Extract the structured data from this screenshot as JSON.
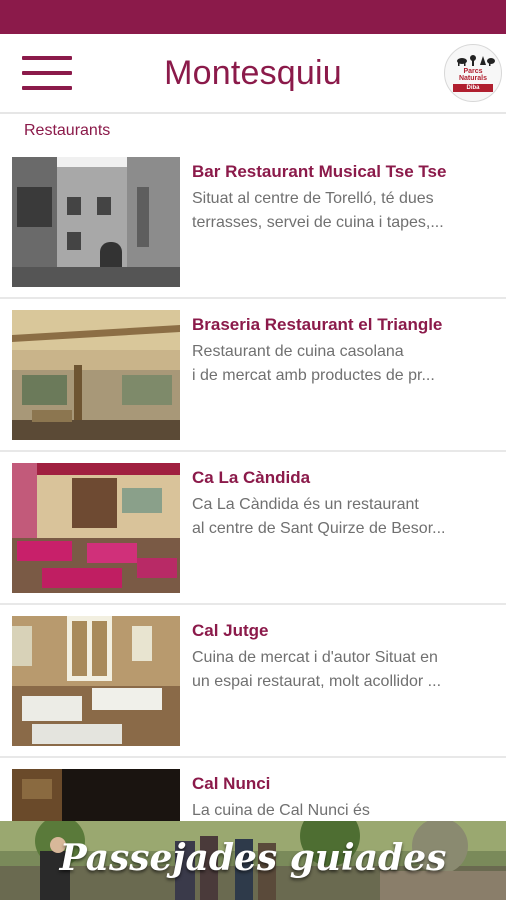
{
  "header": {
    "title": "Montesquiu",
    "logo": {
      "line1": "Parcs",
      "line2": "Naturals",
      "line3": "Diba"
    }
  },
  "section": {
    "label": "Restaurants"
  },
  "items": [
    {
      "title": "Bar Restaurant Musical Tse Tse",
      "desc1": "Situat al centre de Torelló, té dues",
      "desc2": "terrasses, servei de cuina i tapes,..."
    },
    {
      "title": "Braseria Restaurant el Triangle",
      "desc1": "Restaurant de cuina casolana",
      "desc2": "i de mercat amb productes de pr..."
    },
    {
      "title": "Ca La Càndida",
      "desc1": "Ca La Càndida és un restaurant",
      "desc2": "al centre de Sant Quirze de Besor..."
    },
    {
      "title": "Cal Jutge",
      "desc1": "Cuina de mercat i d'autor Situat en",
      "desc2": "un espai restaurat, molt acollidor ..."
    },
    {
      "title": "Cal Nunci",
      "desc1": "La cuina de Cal Nunci és",
      "desc2": ""
    }
  ],
  "banner": {
    "text": "Passejades guiades"
  },
  "colors": {
    "brand": "#8b1a4a",
    "description": "#707070",
    "divider": "#e8e8e8"
  }
}
